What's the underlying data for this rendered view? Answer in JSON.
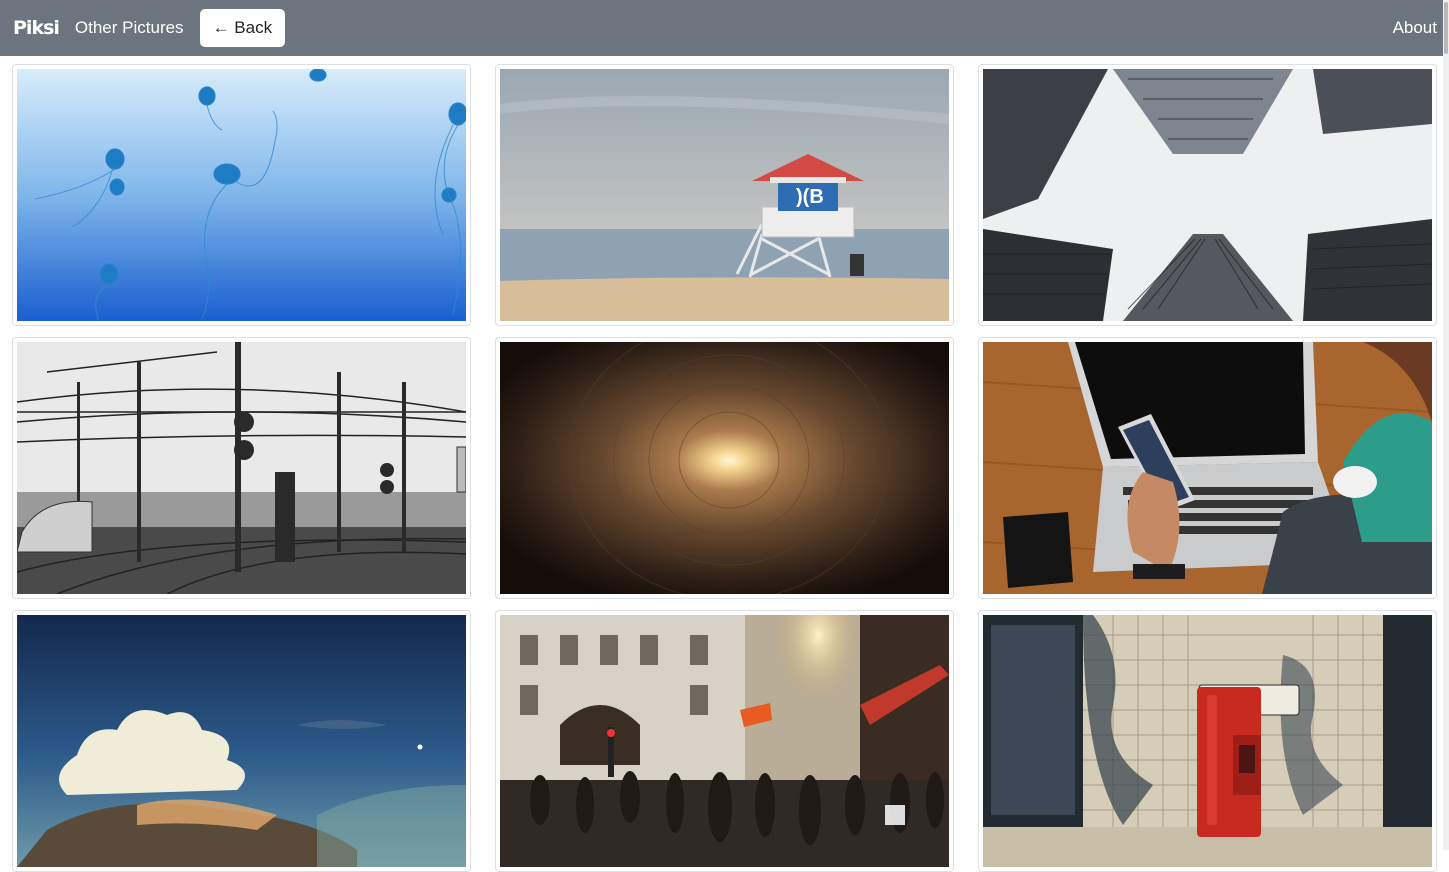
{
  "navbar": {
    "brand": "Piksi",
    "other_pictures": "Other Pictures",
    "back_label": "← Back",
    "about": "About",
    "background": "#6c757d"
  },
  "gallery": {
    "photos": [
      {
        "subject": "jellyfish"
      },
      {
        "subject": "lifeguard tower on beach"
      },
      {
        "subject": "skyscrapers looking up"
      },
      {
        "subject": "railway overhead lines"
      },
      {
        "subject": "tunnel with light"
      },
      {
        "subject": "phone and laptop"
      },
      {
        "subject": "clouds at dusk"
      },
      {
        "subject": "city street crowd"
      },
      {
        "subject": "red alarm box on tiled wall"
      }
    ]
  }
}
